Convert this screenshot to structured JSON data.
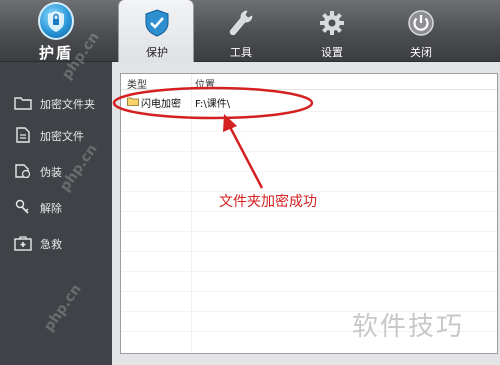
{
  "logo": {
    "text": "护盾"
  },
  "tabs": [
    {
      "label": "保护",
      "icon": "shield-icon",
      "active": true
    },
    {
      "label": "工具",
      "icon": "wrench-icon",
      "active": false
    },
    {
      "label": "设置",
      "icon": "gear-icon",
      "active": false
    },
    {
      "label": "关闭",
      "icon": "power-icon",
      "active": false
    }
  ],
  "sidebar": {
    "items": [
      {
        "label": "加密文件夹",
        "icon": "folder-icon"
      },
      {
        "label": "加密文件",
        "icon": "file-icon"
      },
      {
        "label": "伪装",
        "icon": "disguise-icon"
      },
      {
        "label": "解除",
        "icon": "key-icon"
      },
      {
        "label": "急救",
        "icon": "first-aid-icon"
      }
    ]
  },
  "list": {
    "columns": [
      "类型",
      "位置"
    ],
    "rows": [
      {
        "type": "闪电加密",
        "location": "F:\\课件\\"
      }
    ]
  },
  "annotation": {
    "text": "文件夹加密成功",
    "color": "#d42020"
  },
  "watermark": {
    "text": "软件技巧",
    "diag": "php.cn"
  },
  "colors": {
    "toolbar": "#4c4e52",
    "sidebar": "#3f4246",
    "panel": "#e3e4e6",
    "accent": "#2b97d8"
  }
}
